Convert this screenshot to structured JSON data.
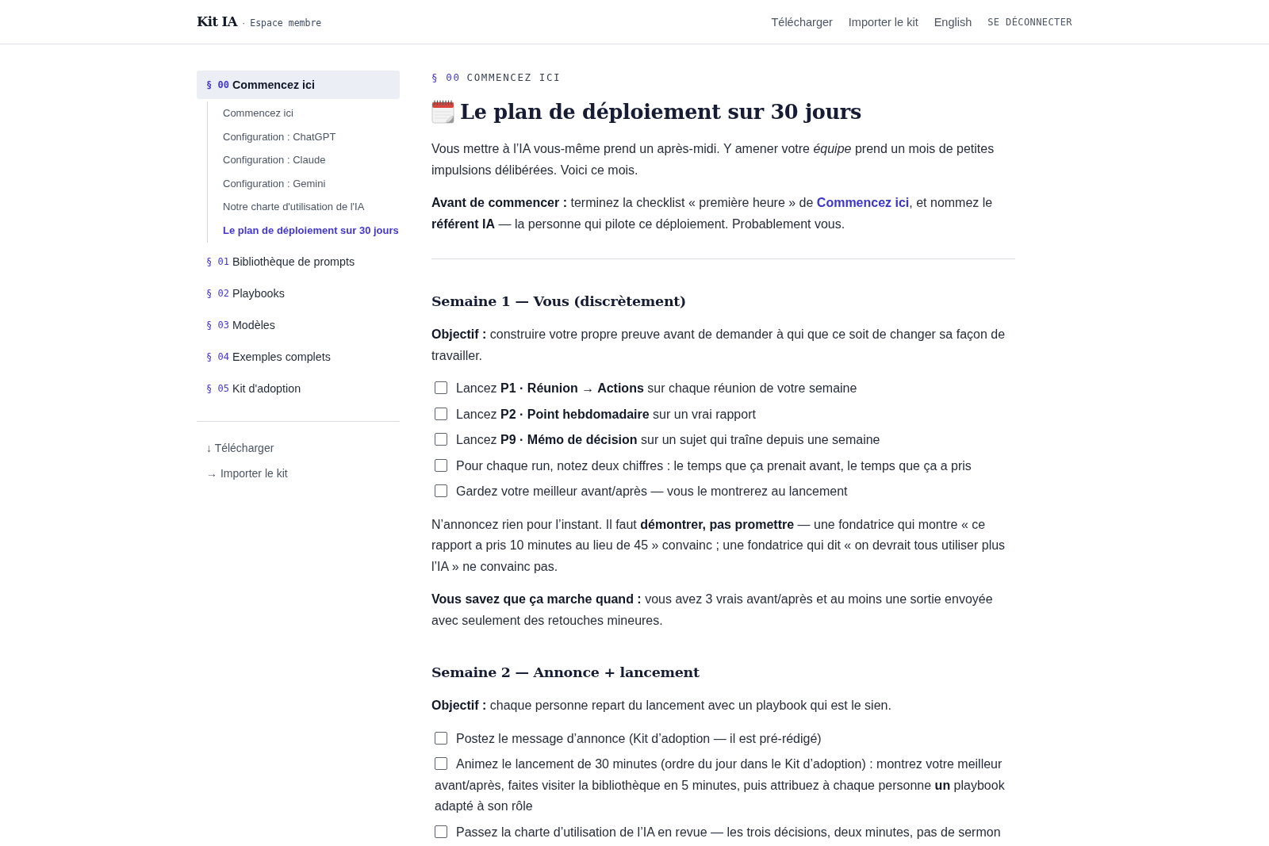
{
  "header": {
    "logo": "Kit IA",
    "separator": "·",
    "subtitle": "Espace membre",
    "nav": [
      {
        "label": "Télécharger",
        "kind": "link"
      },
      {
        "label": "Importer le kit",
        "kind": "link"
      },
      {
        "label": "English",
        "kind": "link"
      },
      {
        "label": "SE DÉCONNECTER",
        "kind": "action"
      }
    ]
  },
  "sidebar": {
    "sections": [
      {
        "number": "§ 00",
        "title": "Commencez ici",
        "selected": true,
        "children": [
          {
            "label": "Commencez ici",
            "selected": false
          },
          {
            "label": "Configuration : ChatGPT",
            "selected": false
          },
          {
            "label": "Configuration : Claude",
            "selected": false
          },
          {
            "label": "Configuration : Gemini",
            "selected": false
          },
          {
            "label": "Notre charte d'utilisation de l'IA",
            "selected": false
          },
          {
            "label": "Le plan de déploiement sur 30 jours",
            "selected": true
          }
        ]
      },
      {
        "number": "§ 01",
        "title": "Bibliothèque de prompts",
        "selected": false
      },
      {
        "number": "§ 02",
        "title": "Playbooks",
        "selected": false
      },
      {
        "number": "§ 03",
        "title": "Modèles",
        "selected": false
      },
      {
        "number": "§ 04",
        "title": "Exemples complets",
        "selected": false
      },
      {
        "number": "§ 05",
        "title": "Kit d'adoption",
        "selected": false
      }
    ],
    "links": [
      {
        "label": "↓ Télécharger"
      },
      {
        "label": "→ Importer le kit"
      }
    ]
  },
  "article": {
    "eyebrow": {
      "number": "§ 00",
      "label": "COMMENCEZ ICI"
    },
    "title": "Le plan de déploiement sur 30 jours",
    "blocks": [
      {
        "kind": "paragraph",
        "text": "Vous mettre à l’IA vous-même prend un après-midi. Y amener votre *équipe* prend un mois de petites impulsions délibérées. Voici ce mois."
      },
      {
        "kind": "paragraph",
        "parts": [
          {
            "kind": "text",
            "text": "**Avant de commencer :** terminez la checklist « première heure » de "
          },
          {
            "kind": "link",
            "text": "Commencez ici"
          },
          {
            "kind": "text",
            "text": ", et nommez le **référent IA** — la personne qui pilote ce déploiement. Probablement vous."
          }
        ]
      },
      {
        "kind": "divider"
      },
      {
        "kind": "heading",
        "text": "Semaine 1 — Vous (discrètement)"
      },
      {
        "kind": "paragraph",
        "text": "**Objectif :** construire votre propre preuve avant de demander à qui que ce soit de changer sa façon de travailler."
      },
      {
        "kind": "checklist",
        "items": [
          {
            "text": "Lancez **P1 · Réunion → Actions** sur chaque réunion de votre semaine",
            "checked": false
          },
          {
            "text": "Lancez **P2 · Point hebdomadaire** sur un vrai rapport",
            "checked": false
          },
          {
            "text": "Lancez **P9 · Mémo de décision** sur un sujet qui traîne depuis une semaine",
            "checked": false
          },
          {
            "text": "Pour chaque run, notez deux chiffres : le temps que ça prenait avant, le temps que ça a pris",
            "checked": false
          },
          {
            "text": "Gardez votre meilleur avant/après — vous le montrerez au lancement",
            "checked": false
          }
        ]
      },
      {
        "kind": "paragraph",
        "text": "N’annoncez rien pour l’instant. Il faut **démontrer, pas promettre** — une fondatrice qui montre « ce rapport a pris 10 minutes au lieu de 45 » convainc ; une fondatrice qui dit « on devrait tous utiliser plus l’IA » ne convainc pas."
      },
      {
        "kind": "paragraph",
        "text": "**Vous savez que ça marche quand :** vous avez 3 vrais avant/après et au moins une sortie envoyée avec seulement des retouches mineures."
      },
      {
        "kind": "heading",
        "text": "Semaine 2 — Annonce + lancement"
      },
      {
        "kind": "paragraph",
        "text": "**Objectif :** chaque personne repart du lancement avec un playbook qui est le sien."
      },
      {
        "kind": "checklist",
        "items": [
          {
            "text": "Postez le message d’annonce (Kit d’adoption — il est pré-rédigé)",
            "checked": false
          },
          {
            "text": "Animez le lancement de 30 minutes (ordre du jour dans le Kit d’adoption) : montrez votre meilleur avant/après, faites visiter la bibliothèque en 5 minutes, puis attribuez à chaque personne **un** playbook adapté à son rôle",
            "checked": false
          },
          {
            "text": "Passez la charte d’utilisation de l’IA en revue — les trois décisions, deux minutes, pas de sermon",
            "checked": false
          }
        ]
      }
    ]
  }
}
